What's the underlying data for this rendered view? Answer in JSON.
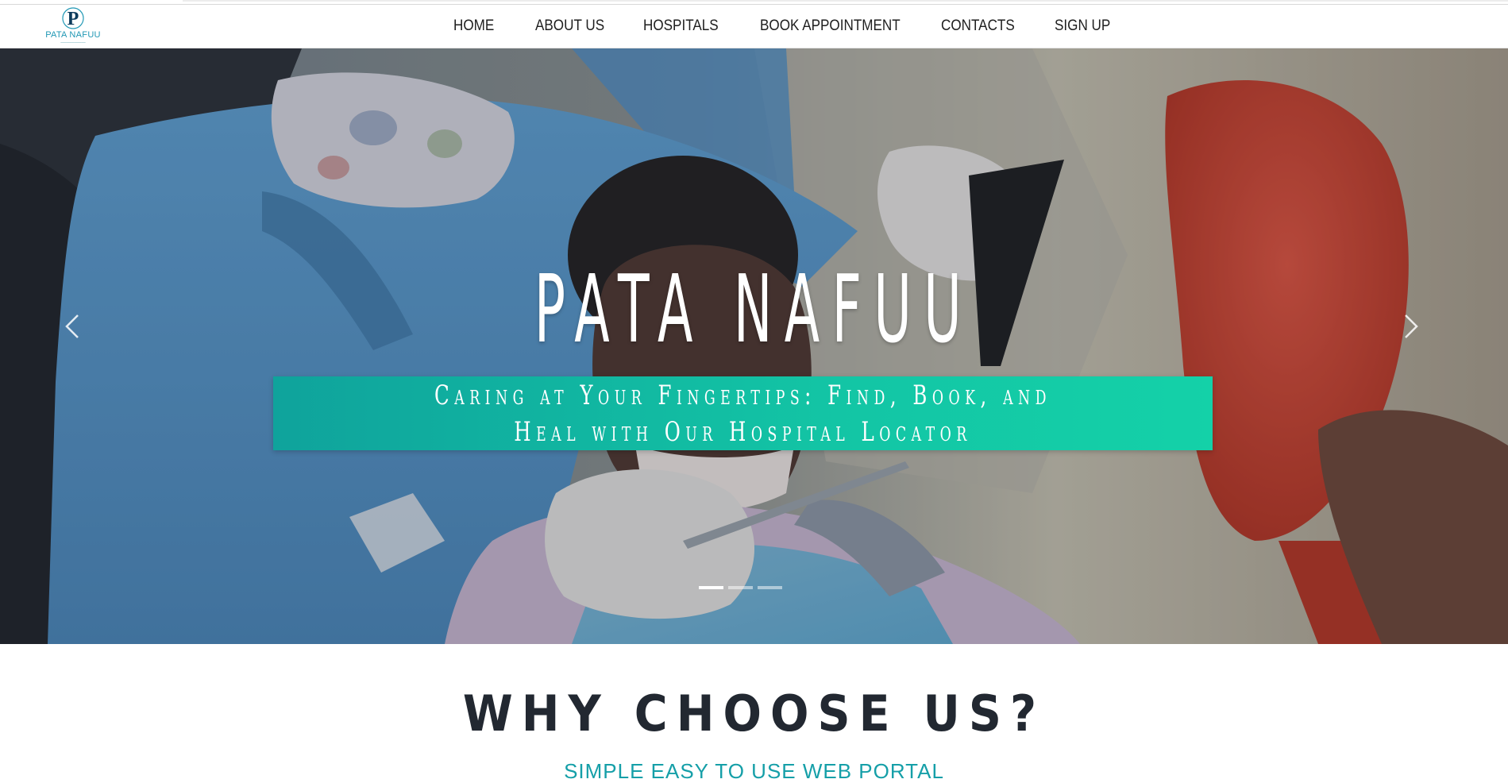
{
  "brand": {
    "name": "PATA NAFUU",
    "logo_letter": "P",
    "primary_color": "#1f97b4",
    "accent_color": "#13c5a5"
  },
  "nav": {
    "items": [
      {
        "label": "HOME"
      },
      {
        "label": "ABOUT US"
      },
      {
        "label": "HOSPITALS"
      },
      {
        "label": "BOOK APPOINTMENT"
      },
      {
        "label": "CONTACTS"
      },
      {
        "label": "SIGN UP"
      }
    ]
  },
  "hero": {
    "title": "PATA NAFUU",
    "tagline": "Caring at Your Fingertips: Find, Book, and Heal with Our Hospital Locator",
    "prev_icon": "chevron-left-icon",
    "next_icon": "chevron-right-icon",
    "slides_total": 3,
    "active_slide": 1
  },
  "why": {
    "title": "WHY CHOOSE US?",
    "subtitle": "SIMPLE EASY TO USE WEB PORTAL"
  }
}
